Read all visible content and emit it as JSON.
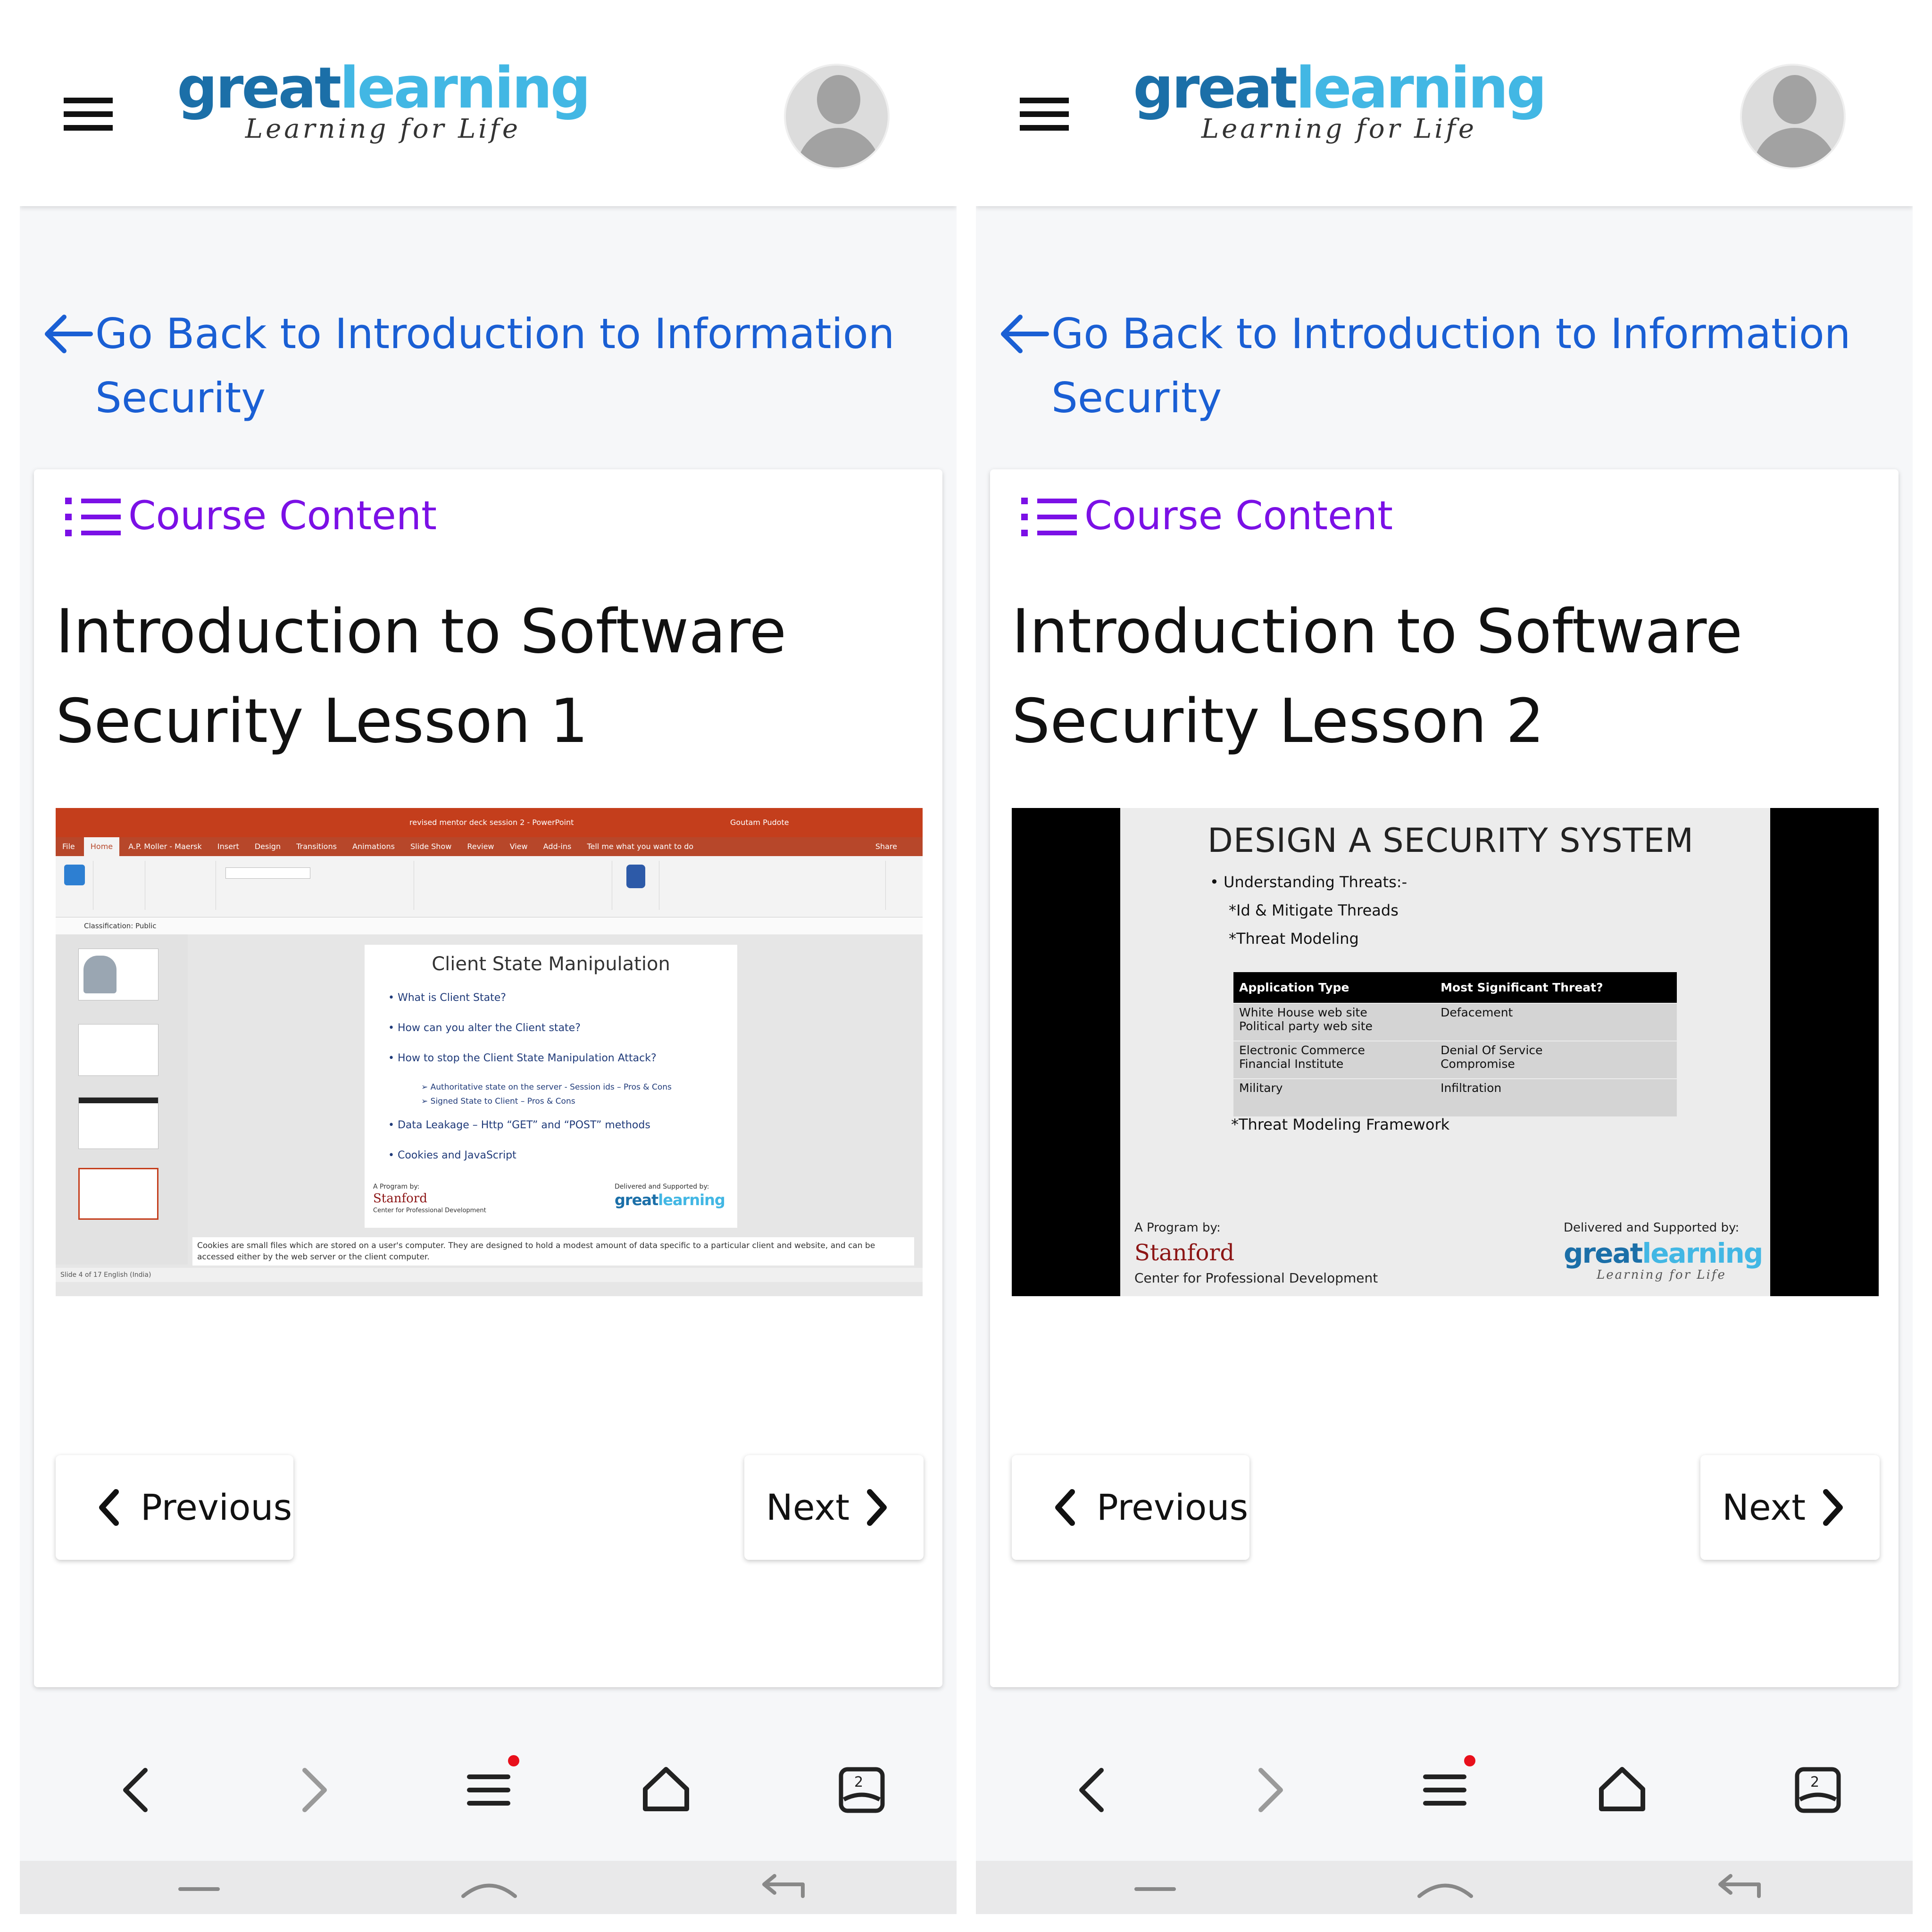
{
  "brand": {
    "logo_part1": "great",
    "logo_part2": "learning",
    "tagline": "Learning for Life",
    "accent_dark": "#1b6fa8",
    "accent_light": "#42b7e4"
  },
  "colors": {
    "link_blue": "#1a5fd4",
    "course_purple": "#7b10e6"
  },
  "icons": [
    "hamburger-icon",
    "avatar-icon",
    "back-arrow-icon",
    "list-icon",
    "chevron-left-icon",
    "chevron-right-icon",
    "browser-back-icon",
    "browser-forward-icon",
    "browser-menu-icon",
    "browser-home-icon",
    "browser-tabs-icon"
  ],
  "panels": [
    {
      "go_back": "Go Back to Introduction to Information Security",
      "course_content": "Course Content",
      "lesson_title": "Introduction to Software Security Lesson 1",
      "prev_label": "Previous",
      "next_label": "Next",
      "tabs_count": "2"
    },
    {
      "go_back": "Go Back to Introduction to Information Security",
      "course_content": "Course Content",
      "lesson_title": "Introduction to Software Security Lesson 2",
      "prev_label": "Previous",
      "next_label": "Next",
      "tabs_count": "2"
    }
  ],
  "video1": {
    "window_title": "revised mentor deck session 2 - PowerPoint",
    "user": "Goutam Pudote",
    "menu": [
      "File",
      "Home",
      "A.P. Moller - Maersk",
      "Insert",
      "Design",
      "Transitions",
      "Animations",
      "Slide Show",
      "Review",
      "View",
      "Add-ins",
      "Tell me what you want to do",
      "Share"
    ],
    "classification": "Classification:  Public",
    "slide_title": "Client State Manipulation",
    "bullets": [
      "What is Client State?",
      "How can you alter the Client state?",
      "How to stop the Client State Manipulation Attack?"
    ],
    "sub_bullets": [
      "Authoritative state on the server - Session ids – Pros & Cons",
      "Signed State to Client – Pros & Cons"
    ],
    "bullets2": [
      "Data Leakage – Http “GET” and “POST” methods",
      "Cookies and JavaScript"
    ],
    "program_by": "A Program by:",
    "stanford": "Stanford",
    "cpd": "Center for Professional Development",
    "delivered": "Delivered and Supported by:",
    "notes": "Cookies are small files which are stored on a user's computer. They are designed to hold a modest amount of data specific to a particular client and website, and can be accessed either by the web server or the client computer.",
    "status": "Slide 4 of 17    English (India)"
  },
  "video2": {
    "title": "DESIGN A SECURITY SYSTEM",
    "bullet1": "•   Understanding Threats:-",
    "bullet2": "*Id & Mitigate Threads",
    "bullet3": "*Threat Modeling",
    "table_headers": [
      "Application Type",
      "Most Significant Threat?"
    ],
    "table_rows": [
      [
        "White House web site\nPolitical party web site",
        "Defacement"
      ],
      [
        "Electronic Commerce\nFinancial Institute",
        "Denial Of Service\nCompromise"
      ],
      [
        "Military",
        "Infiltration"
      ]
    ],
    "footer_note": "*Threat Modeling Framework",
    "program_by": "A Program by:",
    "stanford": "Stanford",
    "cpd": "Center for Professional Development",
    "delivered": "Delivered and Supported by:"
  }
}
